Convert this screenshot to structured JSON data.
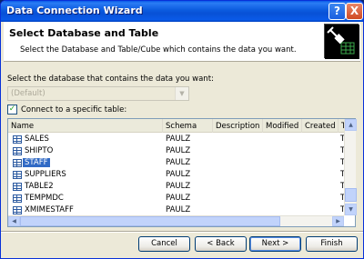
{
  "window": {
    "title": "Data Connection Wizard"
  },
  "title_buttons": {
    "help": "?",
    "close": "X"
  },
  "header": {
    "title": "Select Database and Table",
    "subtitle": "Select the Database and Table/Cube which contains the data you want."
  },
  "database": {
    "label": "Select the database that contains the data you want:",
    "value": "(Default)"
  },
  "connect_checkbox": {
    "label": "Connect to a specific table:",
    "checked": true
  },
  "table": {
    "columns": [
      "Name",
      "Schema",
      "Description",
      "Modified",
      "Created",
      "T"
    ],
    "rows": [
      {
        "name": "SALES",
        "schema": "PAULZ",
        "type": "T"
      },
      {
        "name": "SHIPTO",
        "schema": "PAULZ",
        "type": "T"
      },
      {
        "name": "STAFF",
        "schema": "PAULZ",
        "type": "T",
        "selected": true
      },
      {
        "name": "SUPPLIERS",
        "schema": "PAULZ",
        "type": "T"
      },
      {
        "name": "TABLE2",
        "schema": "PAULZ",
        "type": "T"
      },
      {
        "name": "TEMPMDC",
        "schema": "PAULZ",
        "type": "T"
      },
      {
        "name": "XMIMESTAFF",
        "schema": "PAULZ",
        "type": "T"
      }
    ]
  },
  "buttons": {
    "cancel": "Cancel",
    "back": "< Back",
    "next": "Next >",
    "finish": "Finish"
  },
  "colors": {
    "titlebar": "#0a5ae8",
    "selection": "#316ac5",
    "window_bg": "#ece9d8"
  }
}
